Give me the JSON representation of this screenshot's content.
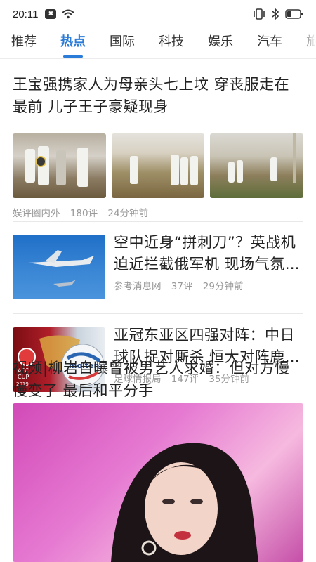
{
  "status_bar": {
    "time": "20:11"
  },
  "tabs": [
    {
      "label": "推荐"
    },
    {
      "label": "热点",
      "active": true
    },
    {
      "label": "国际"
    },
    {
      "label": "科技"
    },
    {
      "label": "娱乐"
    },
    {
      "label": "汽车"
    },
    {
      "label": "旅游"
    }
  ],
  "articles": [
    {
      "title": "王宝强携家人为母亲头七上坟 穿丧服走在最前 儿子王子豪疑现身",
      "source": "娱评圈内外",
      "comments": "180评",
      "time": "24分钟前"
    },
    {
      "title": "空中近身“拼刺刀”？英战机迫近拦截俄军机 现场气氛…",
      "source": "参考消息网",
      "comments": "37评",
      "time": "29分钟前"
    },
    {
      "title": "亚冠东亚区四强对阵：中日球队捉对厮杀 恒大对阵鹿…",
      "source": "足球情报局",
      "comments": "147评",
      "time": "35分钟前"
    },
    {
      "title": "视频|柳岩自曝曾被男艺人求婚：但对方慢慢变了 最后和平分手"
    }
  ],
  "image_texts": {
    "cup_logo_line1": "AFC",
    "cup_logo_line2": "CUP",
    "cup_logo_year": "2019",
    "ball_brand": "molten"
  },
  "icons": [
    "notification-badge-icon",
    "wifi-icon",
    "vibrate-icon",
    "bluetooth-icon",
    "battery-icon"
  ]
}
